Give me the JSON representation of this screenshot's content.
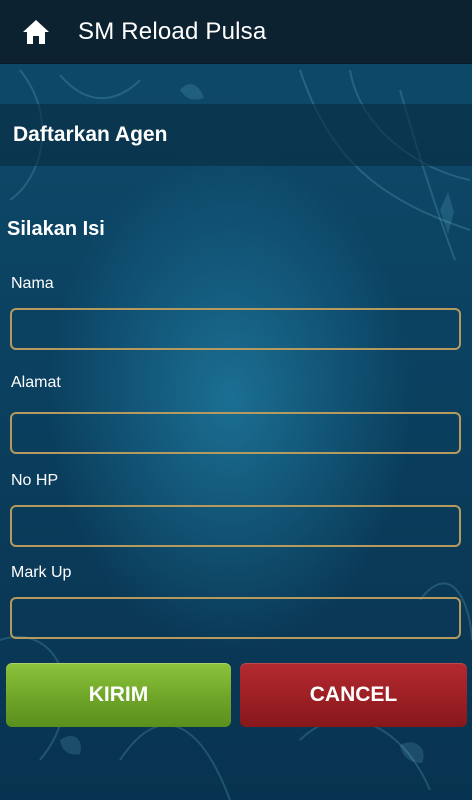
{
  "appbar": {
    "title": "SM Reload Pulsa",
    "home_icon": "home-icon"
  },
  "section": {
    "title": "Daftarkan Agen"
  },
  "form": {
    "subtitle": "Silakan Isi",
    "fields": [
      {
        "label": "Nama",
        "value": "",
        "placeholder": ""
      },
      {
        "label": "Alamat",
        "value": "",
        "placeholder": ""
      },
      {
        "label": "No HP",
        "value": "",
        "placeholder": ""
      },
      {
        "label": "Mark Up",
        "value": "",
        "placeholder": ""
      }
    ]
  },
  "buttons": {
    "submit_label": "KIRIM",
    "cancel_label": "CANCEL"
  },
  "colors": {
    "appbar_bg": "#0d2230",
    "input_border": "#b49a5e",
    "submit_bg": "#6ea528",
    "cancel_bg": "#9c1f24",
    "background": "#0b4262"
  }
}
